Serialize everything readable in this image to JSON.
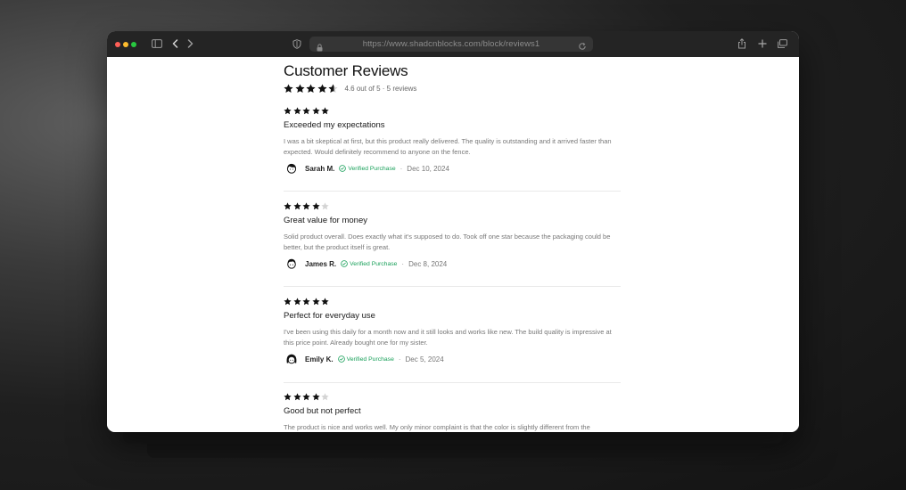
{
  "browser": {
    "url": "https://www.shadcnblocks.com/block/reviews1"
  },
  "page": {
    "title": "Customer Reviews",
    "rating": 4.6,
    "summary": "4.6 out of 5 · 5 reviews"
  },
  "colors": {
    "star": "#111111",
    "star_empty": "#d4d4d4",
    "verified": "#19a05a"
  },
  "reviews": [
    {
      "rating": 5,
      "title": "Exceeded my expectations",
      "body": "I was a bit skeptical at first, but this product really delivered. The quality is outstanding and it arrived faster than expected. Would definitely recommend to anyone on the fence.",
      "author": "Sarah M.",
      "verified_label": "Verified Purchase",
      "separator": "·",
      "date": "Dec 10, 2024"
    },
    {
      "rating": 4,
      "title": "Great value for money",
      "body": "Solid product overall. Does exactly what it's supposed to do. Took off one star because the packaging could be better, but the product itself is great.",
      "author": "James R.",
      "verified_label": "Verified Purchase",
      "separator": "·",
      "date": "Dec 8, 2024"
    },
    {
      "rating": 5,
      "title": "Perfect for everyday use",
      "body": "I've been using this daily for a month now and it still looks and works like new. The build quality is impressive at this price point. Already bought one for my sister.",
      "author": "Emily K.",
      "verified_label": "Verified Purchase",
      "separator": "·",
      "date": "Dec 5, 2024"
    },
    {
      "rating": 4,
      "title": "Good but not perfect",
      "body": "The product is nice and works well. My only minor complaint is that the color is slightly different from the"
    }
  ]
}
